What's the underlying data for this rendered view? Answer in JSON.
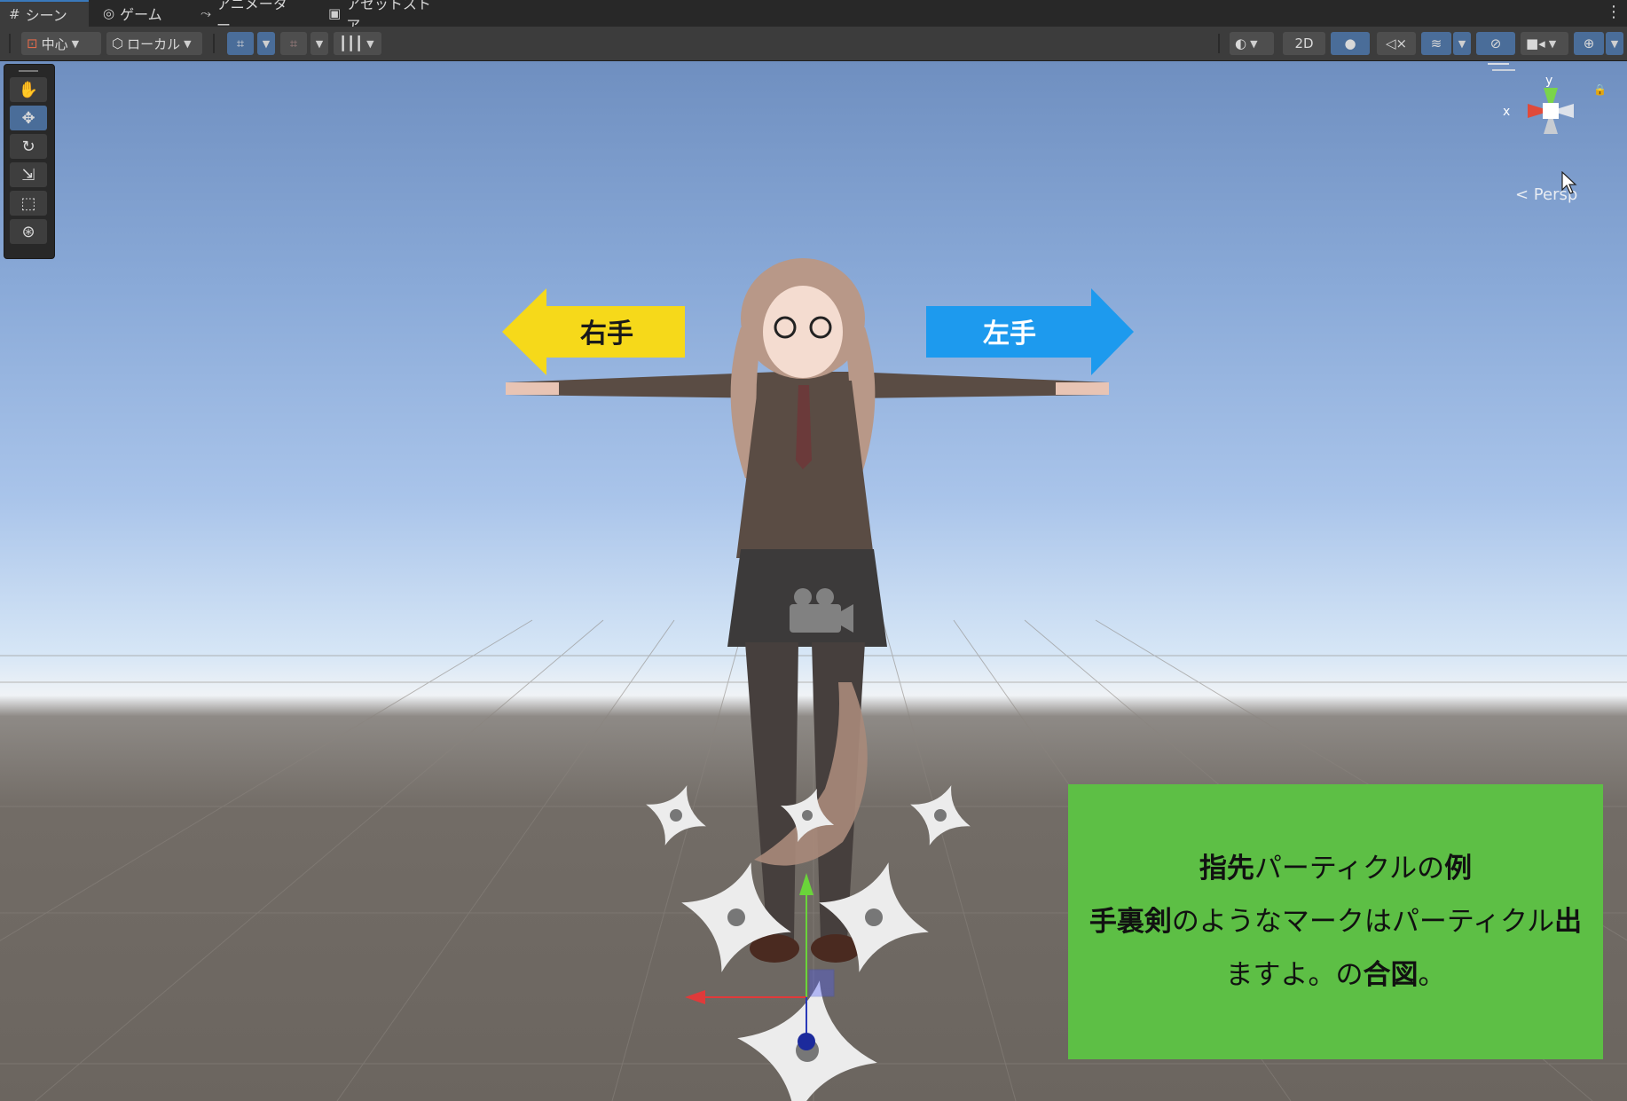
{
  "tabs": [
    {
      "label": "シーン",
      "icon": "grid-icon",
      "active": true
    },
    {
      "label": "ゲーム",
      "icon": "gamepad-icon",
      "active": false
    },
    {
      "label": "アニメーター",
      "icon": "animator-icon",
      "active": false
    },
    {
      "label": "アセットストア",
      "icon": "store-bag-icon",
      "active": false
    }
  ],
  "toolbar": {
    "pivot_label": "中心",
    "space_label": "ローカル",
    "mode_2d_label": "2D"
  },
  "scene": {
    "right_hand_label": "右手",
    "left_hand_label": "左手",
    "projection_label": "< Persp",
    "axis_y_label": "y",
    "axis_x_label": "x",
    "note": {
      "line1_bold_a": "指先",
      "line1_text_a": "パーティクルの",
      "line1_bold_b": "例",
      "line2_bold_a": "手裏剣",
      "line2_text_a": "のようなマークはパーティクル",
      "line2_bold_b": "出",
      "line3_text_a": "ますよ。の",
      "line3_bold_a": "合図",
      "line3_text_b": "。"
    }
  },
  "colors": {
    "right_arrow": "#f6d91a",
    "left_arrow": "#1d9aee",
    "note_bg": "#5dbf45",
    "selected_tool": "#4a6d99"
  }
}
